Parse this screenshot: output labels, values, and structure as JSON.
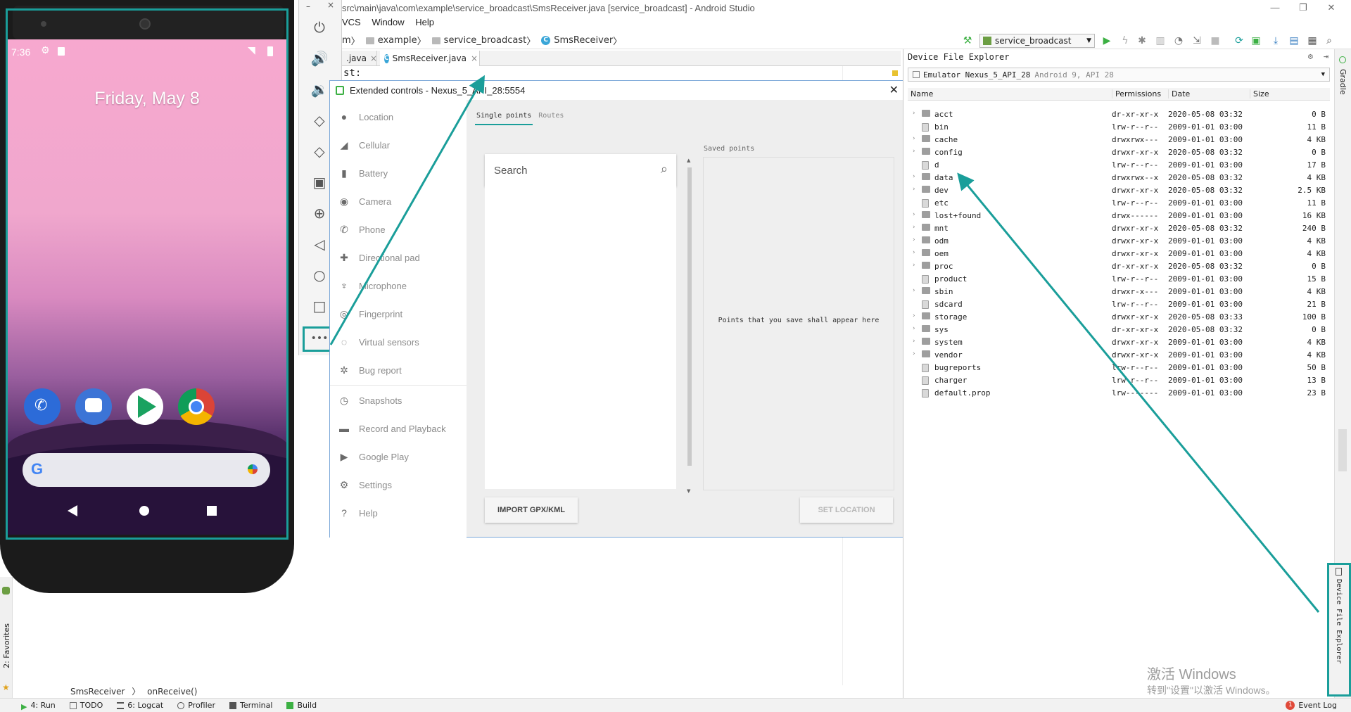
{
  "window": {
    "title": "src\\main\\java\\com\\example\\service_broadcast\\SmsReceiver.java [service_broadcast] - Android Studio",
    "menu": [
      "VCS",
      "Window",
      "Help"
    ]
  },
  "breadcrumb": [
    "m",
    "example",
    "service_broadcast",
    "SmsReceiver"
  ],
  "run_config": "service_broadcast",
  "editor": {
    "tabs": [
      ".java",
      "SmsReceiver.java"
    ],
    "fragment": "st:",
    "breadcrumb": [
      "SmsReceiver",
      "onReceive()"
    ]
  },
  "left_strip": {
    "favorites": "2: Favorites"
  },
  "status_bar": {
    "items": [
      "4: Run",
      "TODO",
      "6: Logcat",
      "Profiler",
      "Terminal",
      "Build"
    ],
    "event_log": "Event Log",
    "event_count": "1"
  },
  "phone": {
    "time": "7:36",
    "date": "Friday, May 8"
  },
  "emulator_toolbar": {
    "icons": [
      "power-icon",
      "volume-up-icon",
      "volume-down-icon",
      "rotate-left-icon",
      "rotate-right-icon",
      "camera-icon",
      "zoom-icon",
      "back-icon",
      "home-icon",
      "overview-icon",
      "more-icon"
    ]
  },
  "extended_controls": {
    "title": "Extended controls - Nexus_5_API_28:5554",
    "nav": [
      {
        "label": "Location",
        "icon": "location-pin-icon"
      },
      {
        "label": "Cellular",
        "icon": "signal-icon"
      },
      {
        "label": "Battery",
        "icon": "battery-icon"
      },
      {
        "label": "Camera",
        "icon": "camera-aperture-icon"
      },
      {
        "label": "Phone",
        "icon": "phone-icon"
      },
      {
        "label": "Directional pad",
        "icon": "dpad-icon"
      },
      {
        "label": "Microphone",
        "icon": "microphone-icon"
      },
      {
        "label": "Fingerprint",
        "icon": "fingerprint-icon"
      },
      {
        "label": "Virtual sensors",
        "icon": "sensors-icon"
      },
      {
        "label": "Bug report",
        "icon": "bug-icon"
      },
      {
        "label": "Snapshots",
        "icon": "snapshot-icon"
      },
      {
        "label": "Record and Playback",
        "icon": "video-icon"
      },
      {
        "label": "Google Play",
        "icon": "play-icon"
      },
      {
        "label": "Settings",
        "icon": "gear-icon"
      },
      {
        "label": "Help",
        "icon": "help-icon"
      }
    ],
    "tabs": [
      "Single points",
      "Routes"
    ],
    "search_placeholder": "Search",
    "saved_points_label": "Saved points",
    "empty_text": "Points that you save shall appear here",
    "import_button": "IMPORT GPX/KML",
    "set_location_button": "SET LOCATION"
  },
  "device_file_explorer": {
    "title": "Device File Explorer",
    "device": "Emulator Nexus_5_API_28",
    "device_detail": "Android 9, API 28",
    "columns": [
      "Name",
      "Permissions",
      "Date",
      "Size"
    ],
    "rows": [
      {
        "name": "acct",
        "perm": "dr-xr-xr-x",
        "date": "2020-05-08 03:32",
        "size": "0 B",
        "type": "dir"
      },
      {
        "name": "bin",
        "perm": "lrw-r--r--",
        "date": "2009-01-01 03:00",
        "size": "11 B",
        "type": "link"
      },
      {
        "name": "cache",
        "perm": "drwxrwx---",
        "date": "2009-01-01 03:00",
        "size": "4 KB",
        "type": "dir"
      },
      {
        "name": "config",
        "perm": "drwxr-xr-x",
        "date": "2020-05-08 03:32",
        "size": "0 B",
        "type": "dir"
      },
      {
        "name": "d",
        "perm": "lrw-r--r--",
        "date": "2009-01-01 03:00",
        "size": "17 B",
        "type": "link"
      },
      {
        "name": "data",
        "perm": "drwxrwx--x",
        "date": "2020-05-08 03:32",
        "size": "4 KB",
        "type": "dir"
      },
      {
        "name": "dev",
        "perm": "drwxr-xr-x",
        "date": "2020-05-08 03:32",
        "size": "2.5 KB",
        "type": "dir"
      },
      {
        "name": "etc",
        "perm": "lrw-r--r--",
        "date": "2009-01-01 03:00",
        "size": "11 B",
        "type": "link"
      },
      {
        "name": "lost+found",
        "perm": "drwx------",
        "date": "2009-01-01 03:00",
        "size": "16 KB",
        "type": "dir"
      },
      {
        "name": "mnt",
        "perm": "drwxr-xr-x",
        "date": "2020-05-08 03:32",
        "size": "240 B",
        "type": "dir"
      },
      {
        "name": "odm",
        "perm": "drwxr-xr-x",
        "date": "2009-01-01 03:00",
        "size": "4 KB",
        "type": "dir"
      },
      {
        "name": "oem",
        "perm": "drwxr-xr-x",
        "date": "2009-01-01 03:00",
        "size": "4 KB",
        "type": "dir"
      },
      {
        "name": "proc",
        "perm": "dr-xr-xr-x",
        "date": "2020-05-08 03:32",
        "size": "0 B",
        "type": "dir"
      },
      {
        "name": "product",
        "perm": "lrw-r--r--",
        "date": "2009-01-01 03:00",
        "size": "15 B",
        "type": "link"
      },
      {
        "name": "sbin",
        "perm": "drwxr-x---",
        "date": "2009-01-01 03:00",
        "size": "4 KB",
        "type": "dir"
      },
      {
        "name": "sdcard",
        "perm": "lrw-r--r--",
        "date": "2009-01-01 03:00",
        "size": "21 B",
        "type": "link"
      },
      {
        "name": "storage",
        "perm": "drwxr-xr-x",
        "date": "2020-05-08 03:33",
        "size": "100 B",
        "type": "dir"
      },
      {
        "name": "sys",
        "perm": "dr-xr-xr-x",
        "date": "2020-05-08 03:32",
        "size": "0 B",
        "type": "dir"
      },
      {
        "name": "system",
        "perm": "drwxr-xr-x",
        "date": "2009-01-01 03:00",
        "size": "4 KB",
        "type": "dir"
      },
      {
        "name": "vendor",
        "perm": "drwxr-xr-x",
        "date": "2009-01-01 03:00",
        "size": "4 KB",
        "type": "dir"
      },
      {
        "name": "bugreports",
        "perm": "lrw-r--r--",
        "date": "2009-01-01 03:00",
        "size": "50 B",
        "type": "link"
      },
      {
        "name": "charger",
        "perm": "lrw-r--r--",
        "date": "2009-01-01 03:00",
        "size": "13 B",
        "type": "link"
      },
      {
        "name": "default.prop",
        "perm": "lrw-------",
        "date": "2009-01-01 03:00",
        "size": "23 B",
        "type": "link"
      }
    ]
  },
  "right_strip": {
    "gradle": "Gradle",
    "device_file_explorer": "Device File Explorer"
  },
  "watermark": {
    "line1": "激活 Windows",
    "line2": "转到\"设置\"以激活 Windows。"
  },
  "colors": {
    "highlight": "#1a9e9a",
    "accent_blue": "#3aa6d8",
    "run_green": "#3cb043"
  }
}
